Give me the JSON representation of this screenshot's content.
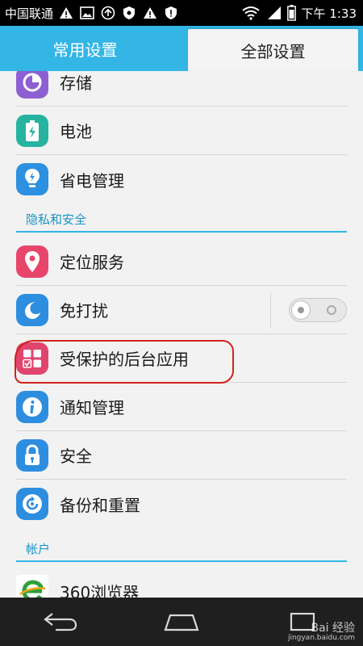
{
  "status_bar": {
    "carrier": "中国联通",
    "time": "下午 1:33"
  },
  "tabs": [
    {
      "label": "常用设置",
      "active": false
    },
    {
      "label": "全部设置",
      "active": true
    }
  ],
  "items_top": [
    {
      "label": "存储",
      "icon": "storage-icon",
      "color": "#8d5fd3"
    },
    {
      "label": "电池",
      "icon": "battery-icon",
      "color": "#26b3a0"
    },
    {
      "label": "省电管理",
      "icon": "bulb-icon",
      "color": "#2d90e0"
    }
  ],
  "section_privacy": "隐私和安全",
  "items_privacy": [
    {
      "label": "定位服务",
      "icon": "location-pin-icon",
      "color": "#e8456b"
    },
    {
      "label": "免打扰",
      "icon": "moon-icon",
      "color": "#2d8ee0",
      "toggle": "off"
    },
    {
      "label": "受保护的后台应用",
      "icon": "protected-apps-icon",
      "color": "#e0456e"
    },
    {
      "label": "通知管理",
      "icon": "info-icon",
      "color": "#2d8ee0"
    },
    {
      "label": "安全",
      "icon": "lock-icon",
      "color": "#2d8ee0"
    },
    {
      "label": "备份和重置",
      "icon": "backup-icon",
      "color": "#2d8ee0"
    }
  ],
  "section_accounts": "帐户",
  "items_accounts": [
    {
      "label": "360浏览器",
      "icon": "browser-360-icon",
      "color": "#2ea03a"
    }
  ],
  "watermark": {
    "brand": "Bai 经验",
    "url": "jingyan.baidu.com"
  },
  "colors": {
    "accent": "#33b5e5",
    "highlight": "#d0231d"
  }
}
